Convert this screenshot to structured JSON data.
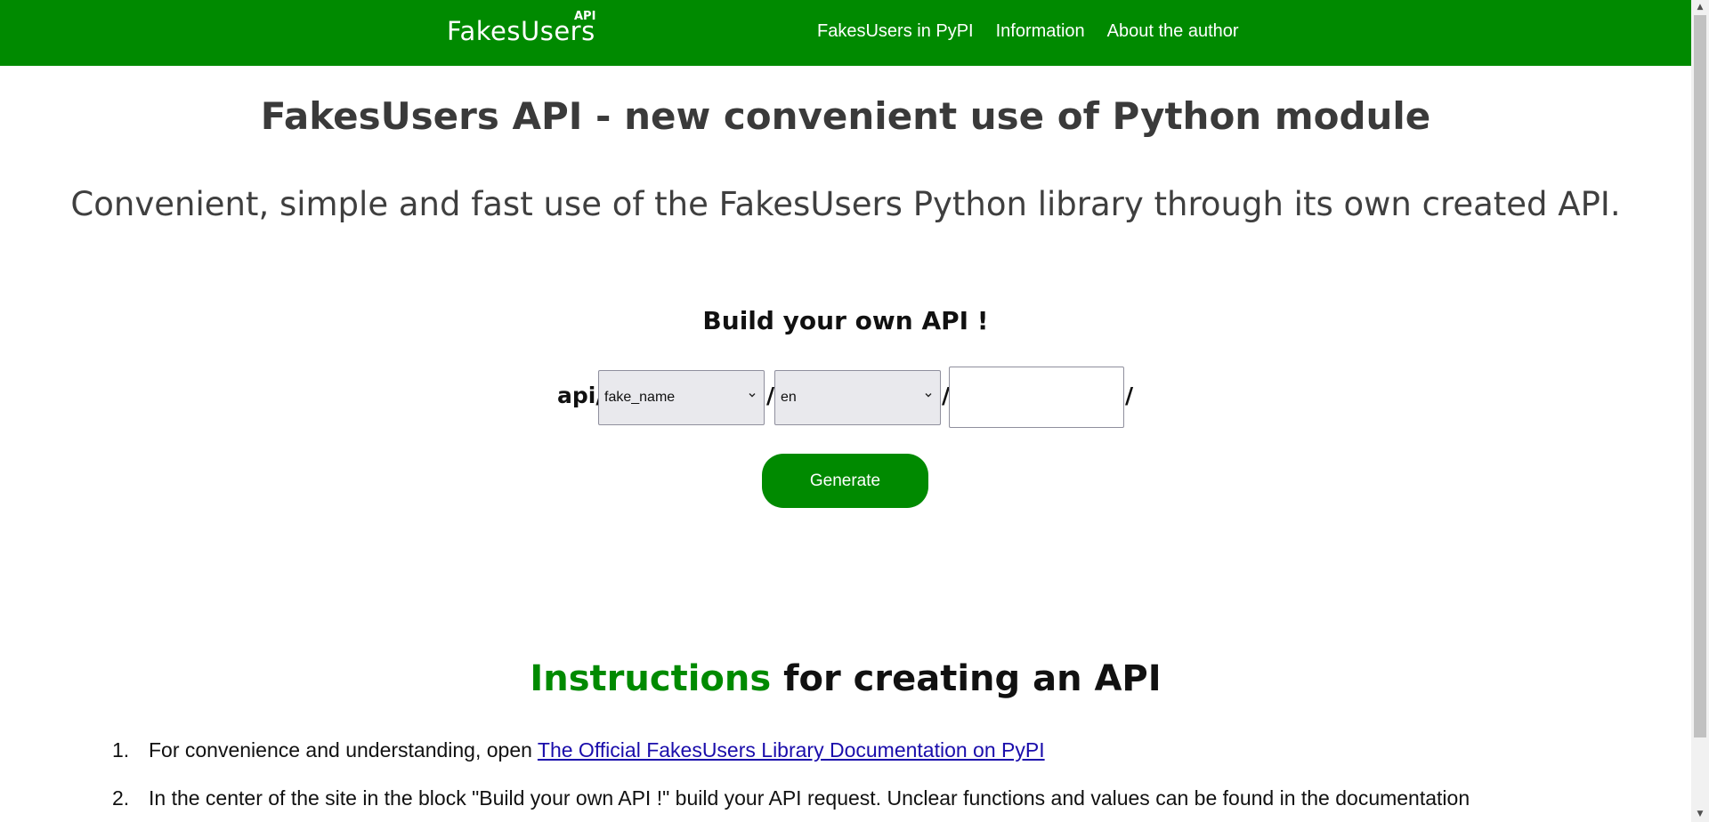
{
  "header": {
    "logo_text": "FakesUsers",
    "logo_sup": "API",
    "nav": [
      {
        "label": "FakesUsers in PyPI"
      },
      {
        "label": "Information"
      },
      {
        "label": "About the author"
      }
    ]
  },
  "main": {
    "title": "FakesUsers API - new convenient use of Python module",
    "subtitle": "Convenient, simple and fast use of the FakesUsers Python library through its own created API."
  },
  "builder": {
    "title": "Build your own API !",
    "prefix": "api/",
    "separator": "/",
    "function_select": {
      "value": "fake_name"
    },
    "language_select": {
      "value": "en"
    },
    "count_input": {
      "value": "",
      "placeholder": ""
    },
    "generate_label": "Generate"
  },
  "instructions": {
    "title_accent": "Instructions",
    "title_rest": " for creating an API",
    "items": [
      {
        "num": "1.",
        "text": "For convenience and understanding, open ",
        "link": "The Official FakesUsers Library Documentation on PyPI"
      },
      {
        "num": "2.",
        "text": "In the center of the site in the block \"Build your own API !\" build your API request. Unclear functions and values can be found in the documentation"
      }
    ]
  },
  "colors": {
    "brand_green": "#008a00",
    "text_dark": "#3a3a3a",
    "link": "#1a0dab"
  }
}
